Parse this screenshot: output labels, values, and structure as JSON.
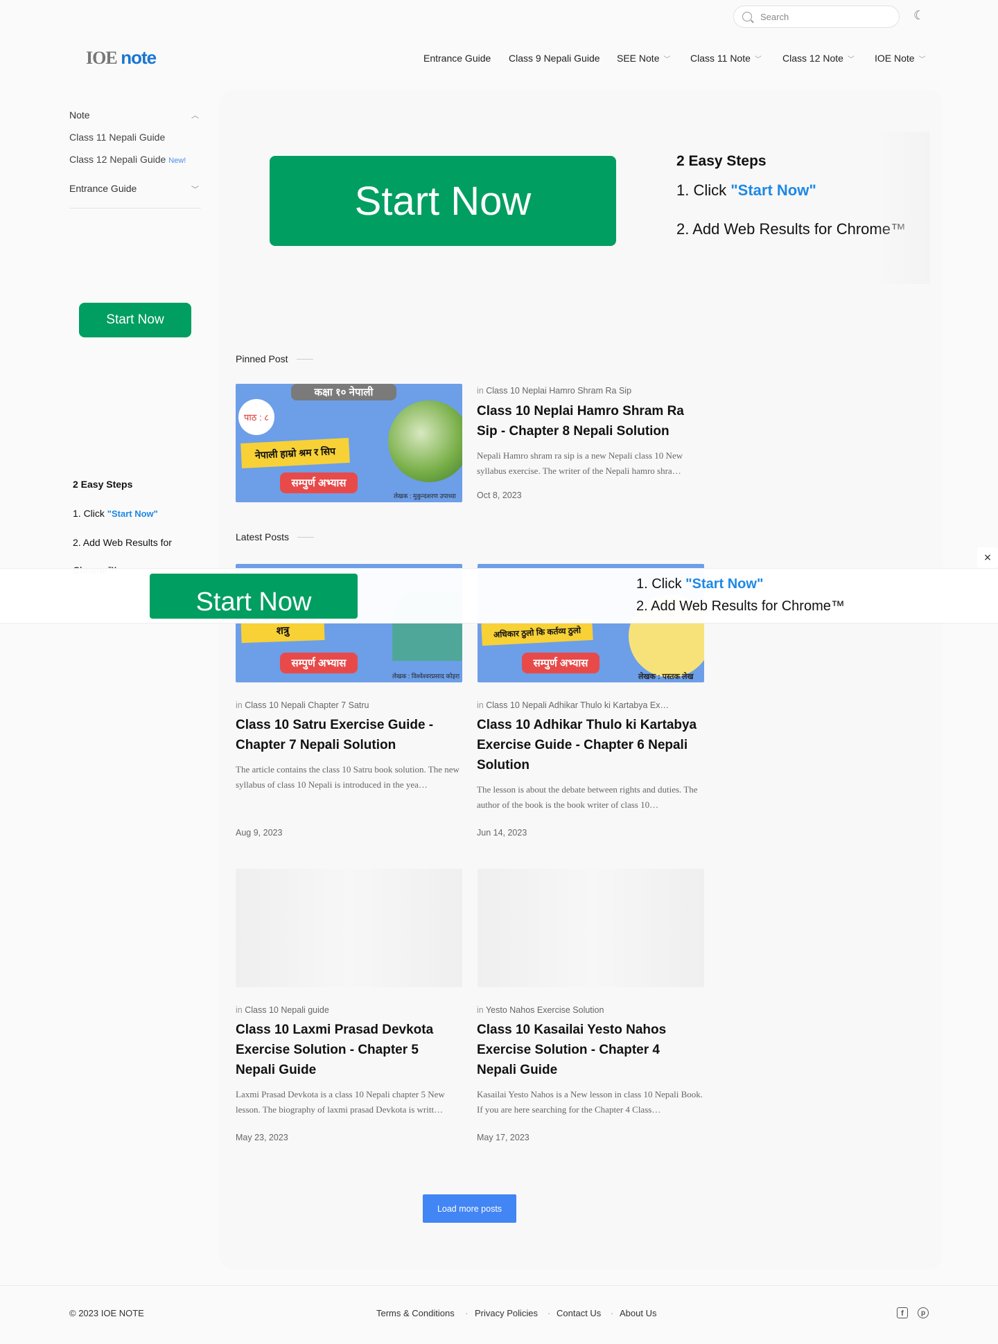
{
  "header": {
    "search_placeholder": "Search",
    "logo_a": "IOE",
    "logo_b": "note",
    "nav": [
      "Entrance Guide",
      "Class 9 Nepali Guide",
      "SEE Note",
      "Class 11 Note",
      "Class 12 Note",
      "IOE Note"
    ]
  },
  "sidebar": {
    "items": [
      "Note",
      "Class 11 Nepali Guide",
      "Class 12 Nepali Guide",
      "Entrance Guide"
    ],
    "new_badge": "New!",
    "ad_button": "Start Now",
    "steps_title": "2 Easy Steps",
    "step1_prefix": "1. Click ",
    "step1_link": "\"Start Now\"",
    "step2": "2. Add Web Results for",
    "step2_cont": "Chrome™"
  },
  "ad": {
    "button": "Start Now",
    "steps_title": "2 Easy Steps",
    "step1_prefix": "1. Click ",
    "step1_link": "\"Start Now\"",
    "step2": "2. Add Web Results for Chrome™"
  },
  "overlay": {
    "button": "Start Now",
    "step1_prefix": "1. Click ",
    "step1_link": "\"Start Now\"",
    "step2": "2. Add Web Results for Chrome™",
    "close": "×"
  },
  "pinned": {
    "label": "Pinned Post",
    "thumb_tag": "कक्षा १० नेपाली",
    "thumb_lesson": "पाठ : ८",
    "thumb_title": "नेपाली हाम्रो श्रम र सिप",
    "thumb_sub": "सम्पुर्ण अभ्यास",
    "thumb_author": "लेखक : मुकुन्दशरण उपाध्या",
    "in": "in",
    "category": "Class 10 Neplai Hamro Shram Ra Sip",
    "title": "Class 10 Neplai Hamro Shram Ra Sip - Chapter 8 Nepali Solution",
    "excerpt": "Nepali Hamro shram ra sip is a new Nepali class 10 New syllabus exercise. The writer of the Nepali hamro shra…",
    "date": "Oct 8, 2023"
  },
  "latest": {
    "label": "Latest Posts",
    "posts": [
      {
        "thumb_title": "शत्रु",
        "thumb_sub": "सम्पुर्ण अभ्यास",
        "thumb_author": "लेखक : विश्वेश्वरप्रसाद कोइरा",
        "category": "Class 10 Nepali Chapter 7 Satru",
        "title": "Class 10 Satru Exercise Guide - Chapter 7 Nepali Solution",
        "excerpt": "The article contains the class 10 Satru book solution. The new syllabus of class 10 Nepali is introduced in the yea…",
        "date": "Aug 9, 2023"
      },
      {
        "thumb_title": "अधिकार ठुलो कि कर्तव्य ठुलो",
        "thumb_sub": "सम्पुर्ण अभ्यास",
        "thumb_author": "लेखक : पस्तक लेख",
        "category": "Class 10 Nepali Adhikar Thulo ki Kartabya Ex…",
        "title": "Class 10 Adhikar Thulo ki Kartabya Exercise Guide - Chapter 6 Nepali Solution",
        "excerpt": "The lesson is about the debate between rights and duties. The author of the book is the book writer of class 10…",
        "date": "Jun 14, 2023"
      },
      {
        "category": "Class 10 Nepali guide",
        "title": "Class 10 Laxmi Prasad Devkota Exercise Solution - Chapter 5 Nepali Guide",
        "excerpt": "Laxmi Prasad Devkota is a class 10 Nepali chapter 5 New lesson. The biography of laxmi prasad Devkota is writt…",
        "date": "May 23, 2023"
      },
      {
        "category": "Yesto Nahos Exercise Solution",
        "title": "Class 10 Kasailai Yesto Nahos Exercise Solution - Chapter 4 Nepali Guide",
        "excerpt": "Kasailai Yesto Nahos is a New lesson in class 10 Nepali Book. If you are here searching for the Chapter 4 Class…",
        "date": "May 17, 2023"
      }
    ],
    "in": "in",
    "load_more": "Load more posts"
  },
  "footer": {
    "copyright": "© 2023 IOE NOTE",
    "links": [
      "Terms & Conditions",
      "Privacy Policies",
      "Contact Us",
      "About Us"
    ],
    "dot": "·",
    "social": [
      "facebook-icon",
      "pinterest-icon"
    ]
  },
  "colors": {
    "accent_green": "#009e60",
    "link_blue": "#1e88e5",
    "button_blue": "#4285f4"
  }
}
